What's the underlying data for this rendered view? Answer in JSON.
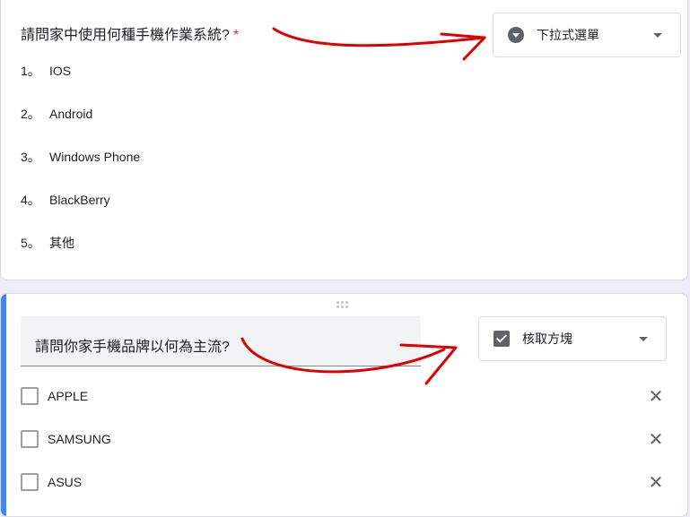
{
  "question1": {
    "title": "請問家中使用何種手機作業系統?",
    "required_mark": "*",
    "type_selector": {
      "label": "下拉式選單",
      "icon": "dropdown-circle-icon"
    },
    "options": [
      {
        "num": "1。",
        "label": "IOS"
      },
      {
        "num": "2。",
        "label": "Android"
      },
      {
        "num": "3。",
        "label": "Windows Phone"
      },
      {
        "num": "4。",
        "label": "BlackBerry"
      },
      {
        "num": "5。",
        "label": "其他"
      }
    ]
  },
  "question2": {
    "title": "請問你家手機品牌以何為主流?",
    "type_selector": {
      "label": "核取方塊",
      "icon": "checkbox-icon"
    },
    "options": [
      {
        "label": "APPLE"
      },
      {
        "label": "SAMSUNG"
      },
      {
        "label": "ASUS"
      }
    ],
    "remove_icon": "✕"
  },
  "colors": {
    "accent": "#4285f4",
    "required": "#d93025",
    "annotation": "#e00000"
  }
}
